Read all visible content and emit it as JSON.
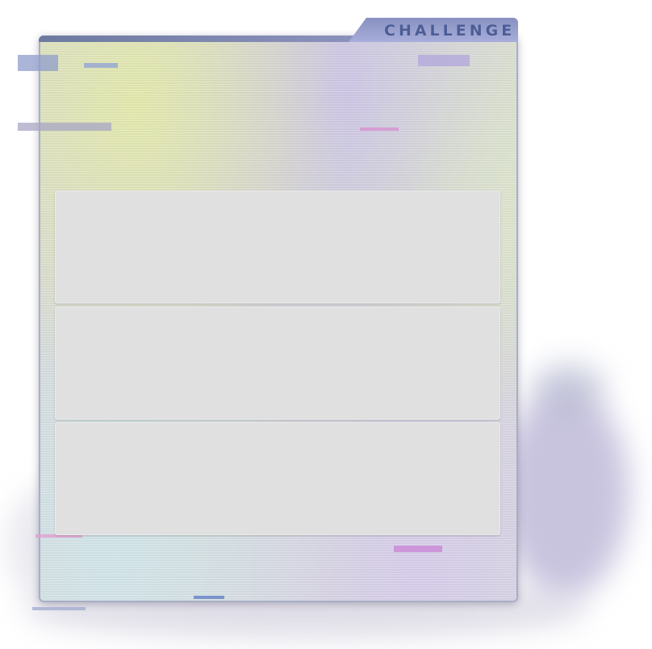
{
  "header": {
    "tab_label": "CHALLENGE"
  },
  "colors": {
    "panel_border": "#a7aec4",
    "tab_background": "#8891c0",
    "tab_text": "#4b5d96",
    "card_background": "#e0e0e0"
  },
  "cards": [
    {
      "content": ""
    },
    {
      "content": ""
    },
    {
      "content": ""
    }
  ]
}
